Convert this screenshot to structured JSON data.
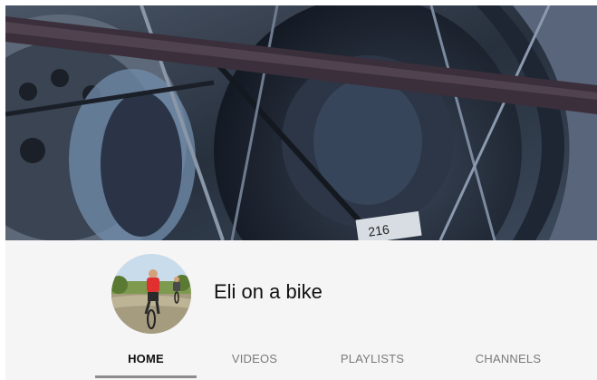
{
  "channel": {
    "name": "Eli on a bike"
  },
  "tabs": [
    {
      "label": "HOME",
      "active": true
    },
    {
      "label": "VIDEOS",
      "active": false
    },
    {
      "label": "PLAYLISTS",
      "active": false
    },
    {
      "label": "CHANNELS",
      "active": false
    }
  ],
  "banner": {
    "hub_label": "216"
  },
  "colors": {
    "header_background": "#f5f5f5",
    "active_tab_text": "#111111",
    "inactive_tab_text": "#7a7a7a",
    "active_tab_underline": "#8c8c8c"
  }
}
